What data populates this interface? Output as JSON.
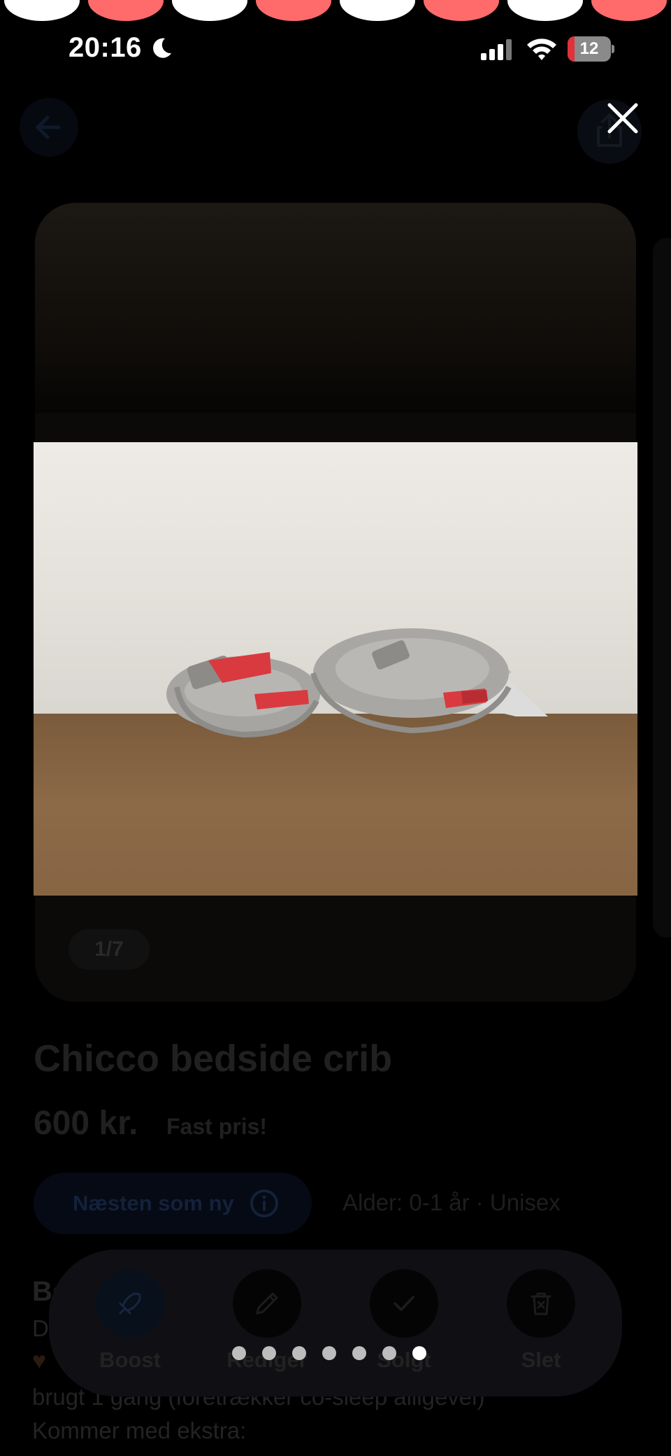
{
  "status_bar": {
    "time": "20:16",
    "battery": "12"
  },
  "listing": {
    "title": "Chicco bedside crib",
    "price": "600 kr.",
    "price_note": "Fast pris!",
    "condition": "Næsten som ny",
    "age": "Alder: 0-1 år · Unisex",
    "description_heading": "Be",
    "description_lines": [
      "D",
      "brugt 1 gang (foretrækker co-sleep alligevel)",
      "Kommer med ekstra:"
    ],
    "image_counter": "1/7"
  },
  "actions": [
    {
      "label": "Boost",
      "icon": "rocket-icon"
    },
    {
      "label": "Rediger",
      "icon": "pencil-icon"
    },
    {
      "label": "Solgt",
      "icon": "check-icon"
    },
    {
      "label": "Slet",
      "icon": "trash-icon"
    }
  ],
  "viewer": {
    "image_count": 7,
    "current_image": 7,
    "photo": "Two rolled grey straps with red buckles against white fabric on a brown surface"
  },
  "colors": {
    "accent_red": "#ff6b6b",
    "status_red": "#e0323a",
    "background": "#000000"
  }
}
